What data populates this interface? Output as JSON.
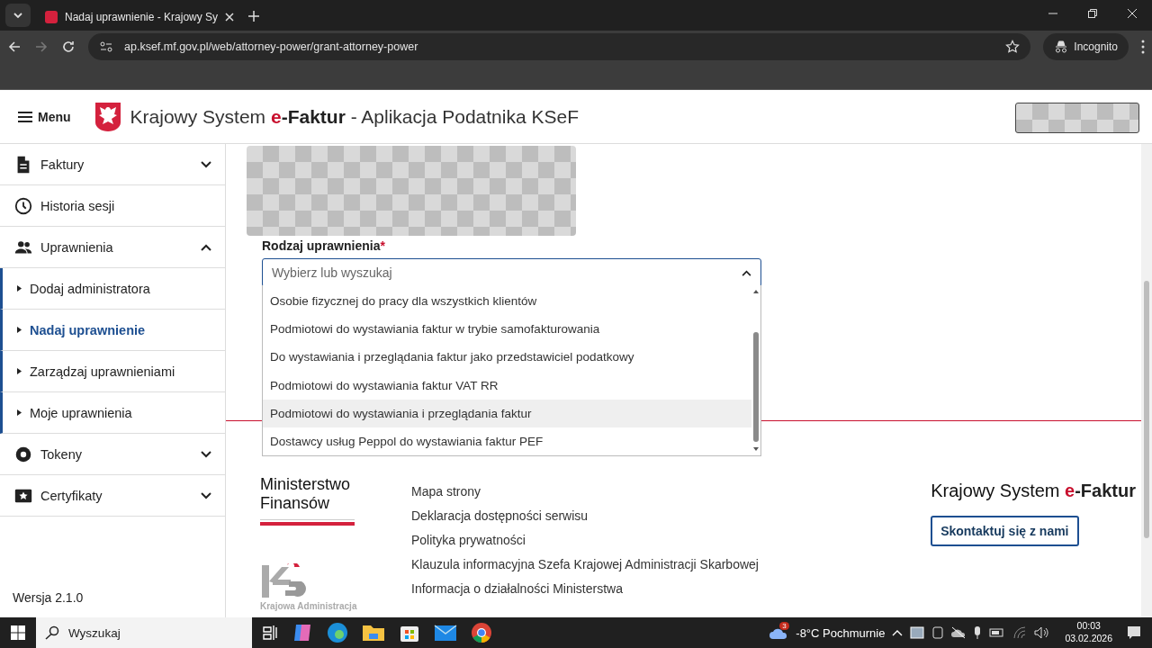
{
  "browser": {
    "tab_title": "Nadaj uprawnienie - Krajowy Sy",
    "url": "ap.ksef.mf.gov.pl/web/attorney-power/grant-attorney-power",
    "profile": "Incognito"
  },
  "header": {
    "menu": "Menu",
    "title": {
      "lead": "Krajowy System",
      "brand_mark": "e",
      "brand": "-Faktur",
      "tail": "- Aplikacja Podatnika KSeF"
    }
  },
  "sidebar": {
    "items": [
      {
        "label": "Faktury",
        "expanded": false
      },
      {
        "label": "Historia sesji"
      },
      {
        "label": "Uprawnienia",
        "expanded": true,
        "children": [
          {
            "label": "Dodaj administratora",
            "selected": false
          },
          {
            "label": "Nadaj uprawnienie",
            "selected": true
          },
          {
            "label": "Zarządzaj uprawnieniami",
            "selected": false
          },
          {
            "label": "Moje uprawnienia",
            "selected": false
          }
        ]
      },
      {
        "label": "Tokeny",
        "expanded": false
      },
      {
        "label": "Certyfikaty",
        "expanded": false
      }
    ],
    "version": "Wersja 2.1.0"
  },
  "form": {
    "label": "Rodzaj uprawnienia",
    "required_mark": "*",
    "field": {
      "placeholder": "Wybierz lub wyszukaj",
      "expanded": true
    },
    "options": [
      {
        "label": "Osobie fizycznej do pracy dla wszystkich klientów",
        "highlighted": false
      },
      {
        "label": "Podmiotowi do wystawiania faktur w trybie samofakturowania",
        "highlighted": false
      },
      {
        "label": "Do wystawiania i przeglądania faktur jako przedstawiciel podatkowy",
        "highlighted": false
      },
      {
        "label": "Podmiotowi do wystawiania faktur VAT RR",
        "highlighted": false
      },
      {
        "label": "Podmiotowi do wystawiania i przeglądania faktur",
        "highlighted": true
      },
      {
        "label": "Dostawcy usług Peppol do wystawiania faktur PEF",
        "highlighted": false
      }
    ]
  },
  "footer": {
    "ministry": "Ministerstwo Finansów",
    "kas": "Krajowa Administracja",
    "links": [
      "Mapa strony",
      "Deklaracja dostępności serwisu",
      "Polityka prywatności",
      "Klauzula informacyjna Szefa Krajowej Administracji Skarbowej",
      "Informacja o działalności Ministerstwa"
    ],
    "brand": {
      "lead": "Krajowy System",
      "brand_mark": "e",
      "brand": "-Faktur"
    },
    "contact": "Skontaktuj się z nami"
  },
  "taskbar": {
    "search": "Wyszukaj",
    "weather_badge": "3",
    "weather": "-8°C Pochmurnie",
    "time": "00:03",
    "date": "03.02.2026"
  }
}
